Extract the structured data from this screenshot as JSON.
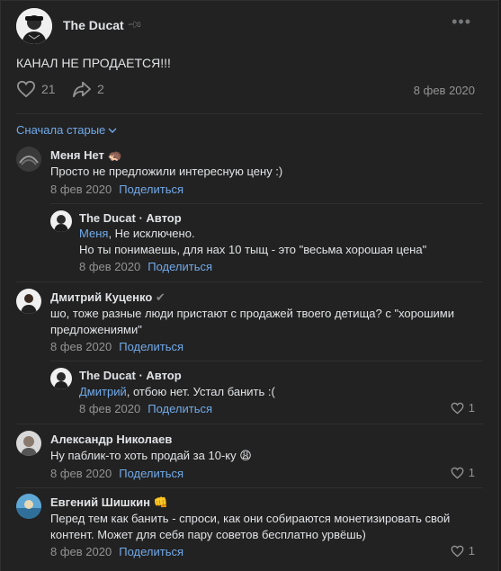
{
  "post": {
    "author": "The Ducat",
    "text": "КАНАЛ НЕ ПРОДАЕТСЯ!!!",
    "likes": "21",
    "shares": "2",
    "date": "8 фев 2020"
  },
  "comments_sort": "Сначала старые",
  "share_label": "Поделиться",
  "comments": [
    {
      "name": "Меня Нет",
      "text": "Просто не предложили интересную цену :)",
      "date": "8 фев 2020"
    },
    {
      "name": "The Ducat · Автор",
      "mention": "Меня",
      "line1_rest": ", Не исключено.",
      "line2": "Но ты понимаешь, для нах 10 тыщ - это \"весьма хорошая цена\"",
      "date": "8 фев 2020"
    },
    {
      "name": "Дмитрий Куценко",
      "text": "шо, тоже разные люди пристают с продажей твоего детища? с \"хорошими предложениями\"",
      "date": "8 фев 2020"
    },
    {
      "name": "The Ducat · Автор",
      "mention": "Дмитрий",
      "rest": ", отбою нет. Устал банить :(",
      "date": "8 фев 2020",
      "likes": "1"
    },
    {
      "name": "Александр Николаев",
      "text": "Ну паблик-то хоть продай за 10-ку",
      "emoji": "😩",
      "date": "8 фев 2020",
      "likes": "1"
    },
    {
      "name": "Евгений Шишкин",
      "badge": "👊",
      "text": "Перед тем как банить - спроси, как они собираются монетизировать свой контент. Может для себя пару советов бесплатно урвёшь)",
      "date": "8 фев 2020",
      "likes": "1"
    }
  ]
}
